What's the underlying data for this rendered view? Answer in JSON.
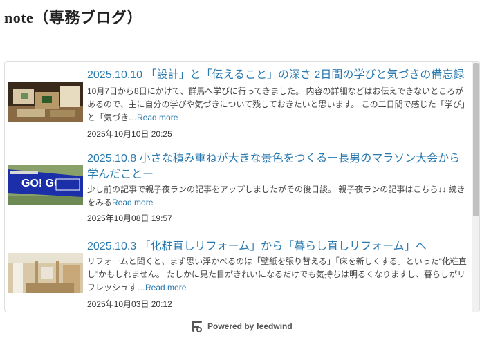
{
  "page": {
    "title": "note（専務ブログ）"
  },
  "feed": {
    "items": [
      {
        "title": "2025.10.10 「設計」と「伝えること」の深さ 2日間の学びと気づきの備忘録",
        "description": "10月7日から8日にかけて、群馬へ学びに行ってきました。 内容の詳細などはお伝えできないところがあるので、主に自分の学びや気づきについて残しておきたいと思います。 この二日間で感じた「学び」と「気づき…",
        "read_more": "Read more",
        "date": "2025年10月10日 20:25",
        "thumbnail": "model-house-photo"
      },
      {
        "title": "2025.10.8 小さな積み重ねが大きな景色をつくるー長男のマラソン大会から学んだことー",
        "description": "少し前の記事で親子夜ランの記事をアップしましたがその後日談。 親子夜ランの記事はこちら↓↓ 続きをみる",
        "read_more": "Read more",
        "date": "2025年10月08日 19:57",
        "thumbnail": "marathon-banner-photo",
        "banner_text": "GO! GO!"
      },
      {
        "title": "2025.10.3 「化粧直しリフォーム」から「暮らし直しリフォーム」へ",
        "description": "リフォームと聞くと、まず思い浮かべるのは「壁紙を張り替える」「床を新しくする」といった“化粧直し”かもしれません。 たしかに見た目がきれいになるだけでも気持ちは明るくなりますし、暮らしがリフレッシュす…",
        "read_more": "Read more",
        "date": "2025年10月03日 20:12",
        "thumbnail": "renovation-interior-photo"
      }
    ]
  },
  "footer": {
    "powered_by": "Powered by feedwind",
    "icon": "feedwind-logo-icon"
  },
  "colors": {
    "link": "#2a7ab0",
    "text": "#444444",
    "border": "#dddddd"
  }
}
